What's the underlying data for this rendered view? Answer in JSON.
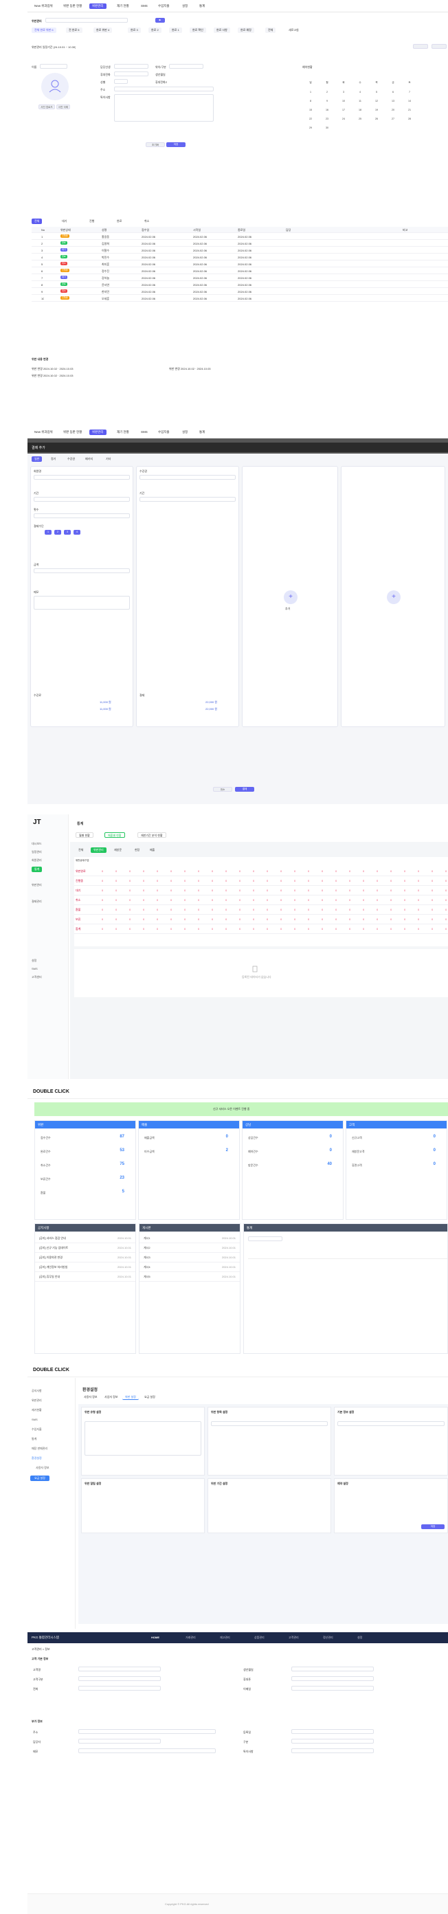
{
  "s1": {
    "gnb": [
      "New 위과업위",
      "위판 동판 현황",
      "위판관리",
      "재기 현황",
      "SMS",
      "수입지출",
      "설정",
      "통계"
    ],
    "filter_label": "위판관리",
    "filter_tags": [
      "전체 완료 위판 6",
      "전 완료 5",
      "완료 위판 4",
      "완료 3",
      "완료 2",
      "완료 1",
      "완료 확인",
      "완료 사항",
      "완료 예정",
      "전체",
      "위판목록"
    ],
    "reset": "새로고침",
    "period": "위판관리 일정기간 (24.10.01 ~ 10.30)",
    "form_labels": [
      "이름",
      "담당선생",
      "휴대전화",
      "성별",
      "주소",
      "특이사항",
      "위치/구분",
      "생년월일",
      "휴대전화2"
    ],
    "avatar_btns": [
      "사진 업로드",
      "사진 삭제"
    ],
    "calendar_title": "예약현황",
    "cal_head": [
      "일",
      "월",
      "화",
      "수",
      "목",
      "금",
      "토"
    ],
    "cal_days": [
      "1",
      "2",
      "3",
      "4",
      "5",
      "6",
      "7",
      "8",
      "9",
      "10",
      "11",
      "12",
      "13",
      "14",
      "15",
      "16",
      "17",
      "18",
      "19",
      "20",
      "21",
      "22",
      "23",
      "24",
      "25",
      "26",
      "27",
      "28",
      "29",
      "30"
    ],
    "form_btns": [
      "초기화",
      "저장"
    ],
    "tabs": [
      "전체",
      "대기",
      "진행",
      "완료",
      "취소"
    ],
    "table_head": [
      "No",
      "위판상태",
      "성명",
      "접수일",
      "시작일",
      "종료일",
      "담당",
      "비고"
    ],
    "rows": [
      {
        "no": "1",
        "status": "진행중",
        "color": "#f59e0b",
        "name": "홍길동",
        "date": "2024.02.06"
      },
      {
        "no": "2",
        "status": "완료",
        "color": "#22c55e",
        "name": "김영희",
        "date": "2024.02.06"
      },
      {
        "no": "3",
        "status": "대기",
        "color": "#6366f1",
        "name": "이철수",
        "date": "2024.02.06"
      },
      {
        "no": "4",
        "status": "완료",
        "color": "#22c55e",
        "name": "박민수",
        "date": "2024.02.06"
      },
      {
        "no": "5",
        "status": "취소",
        "color": "#ef4444",
        "name": "최지훈",
        "date": "2024.02.06"
      },
      {
        "no": "6",
        "status": "진행중",
        "color": "#f59e0b",
        "name": "정수진",
        "date": "2024.02.06"
      },
      {
        "no": "7",
        "status": "대기",
        "color": "#6366f1",
        "name": "강하늘",
        "date": "2024.02.06"
      },
      {
        "no": "8",
        "status": "완료",
        "color": "#22c55e",
        "name": "윤서연",
        "date": "2024.02.06"
      },
      {
        "no": "9",
        "status": "취소",
        "color": "#ef4444",
        "name": "한지민",
        "date": "2024.02.06"
      },
      {
        "no": "10",
        "status": "진행중",
        "color": "#f59e0b",
        "name": "오세훈",
        "date": "2024.02.06"
      }
    ],
    "history_title": "위판 내용 변경",
    "history": [
      "위판 변경 2024.10.02 · 2024.10.03",
      "위판 변경 2024.10.02 · 2024.10.03",
      "위판 변경 2024.10.02 · 2024.10.03"
    ]
  },
  "s2": {
    "gnb": [
      "New 위과업위",
      "위판 동판 현황",
      "위판관리",
      "재기 현황",
      "SMS",
      "수입지출",
      "설정",
      "통계"
    ],
    "modal_title": "결제 추가",
    "tabs": [
      "일반",
      "정기",
      "수강권",
      "패키지",
      "기타"
    ],
    "col_labels": [
      "회원명",
      "수강권",
      "기간",
      "횟수",
      "결제수단",
      "금액",
      "메모"
    ],
    "totals": [
      "수강료",
      "할인",
      "결제",
      "미수금"
    ],
    "amounts": [
      "11,000 원",
      "11,000 원",
      "22,000 원",
      "22,000 원"
    ],
    "add_label": "추가",
    "btns": [
      "취소",
      "결제"
    ]
  },
  "s3": {
    "title": "통계",
    "logo": "JT",
    "tabs": [
      "월별 현황",
      "매출별 현황",
      "재판기간 분석 현황"
    ],
    "sub_tabs": [
      "전체",
      "위판관리",
      "재방문",
      "현장",
      "매출"
    ],
    "side": [
      "대시보드",
      "일정관리",
      "회원관리",
      "위판관리",
      "결제관리",
      "통계",
      "설정",
      "SMS",
      "고객센터"
    ],
    "matrix_head": "위판상태/구분",
    "matrix_rows": [
      "위판완료",
      "진행중",
      "대기",
      "취소",
      "환불",
      "보류",
      "합계"
    ],
    "no_data": "등록된 데이터가 없습니다"
  },
  "s4": {
    "logo": "DOUBLE CLICK",
    "banner": "신규 서비스 오픈 이벤트 진행 중",
    "cards": [
      {
        "title": "위판",
        "color": "#3b82f6",
        "rows": [
          [
            "접수건수",
            "87"
          ],
          [
            "완료건수",
            "53"
          ],
          [
            "취소건수",
            "75"
          ],
          [
            "보류건수",
            "23"
          ],
          [
            "환불",
            "5"
          ]
        ]
      },
      {
        "title": "매출",
        "color": "#3b82f6",
        "rows": [
          [
            "매출금액",
            "0"
          ],
          [
            "미수금액",
            "2"
          ]
        ]
      },
      {
        "title": "상담",
        "color": "#3b82f6",
        "rows": [
          [
            "상담건수",
            "0"
          ],
          [
            "예약건수",
            "0"
          ],
          [
            "방문건수",
            "40"
          ]
        ]
      },
      {
        "title": "고객",
        "color": "#3b82f6",
        "rows": [
          [
            "신규고객",
            "0"
          ],
          [
            "재방문고객",
            "0"
          ],
          [
            "휴면고객",
            "0"
          ]
        ]
      }
    ],
    "lists": [
      "공지사항",
      "게시판",
      "통계"
    ],
    "notices": [
      "[공지] 서비스 점검 안내",
      "[공지] 신규 기능 업데이트",
      "[공지] 이용약관 변경",
      "[공지] 개인정보 처리방침",
      "[공지] 휴무일 안내"
    ],
    "board": [
      "게시1",
      "게시2",
      "게시3",
      "게시4",
      "게시5"
    ],
    "dates": [
      "2024.10.01",
      "2024.10.01",
      "2024.10.01",
      "2024.10.01",
      "2024.10.01"
    ]
  },
  "s5": {
    "logo": "DOUBLE CLICK",
    "title": "환경설정",
    "tabs": [
      "사용자 정보",
      "사업자 정보",
      "위판 설정",
      "요금 설정"
    ],
    "side": [
      "공지사항",
      "위판관리",
      "재기현황",
      "SMS",
      "수입지출",
      "통계",
      "매장 판매관리",
      "환경설정",
      "사용자 정보",
      "요금 설정"
    ],
    "panels": [
      "위판 유형 설정",
      "위판 항목 설정",
      "기본 정보 설정",
      "위판 알림 설정",
      "위판 기간 설정",
      "예약 설정"
    ],
    "save": "저장"
  },
  "s6": {
    "logo": "PKG 통합관리시스템",
    "gnb": [
      "HOME",
      "거래관리",
      "재고관리",
      "상품관리",
      "고객관리",
      "정산관리",
      "설정"
    ],
    "breadcrumb": "고객관리 > 정보",
    "sec_titles": [
      "고객 기본 정보",
      "부가 정보"
    ],
    "labels": [
      "고객명",
      "고객구분",
      "전화",
      "생년월일",
      "휴대폰",
      "이메일",
      "주소",
      "담당자",
      "메모",
      "등록일",
      "구분",
      "특이사항"
    ],
    "footer": "Copyright © PKG All rights reserved"
  }
}
